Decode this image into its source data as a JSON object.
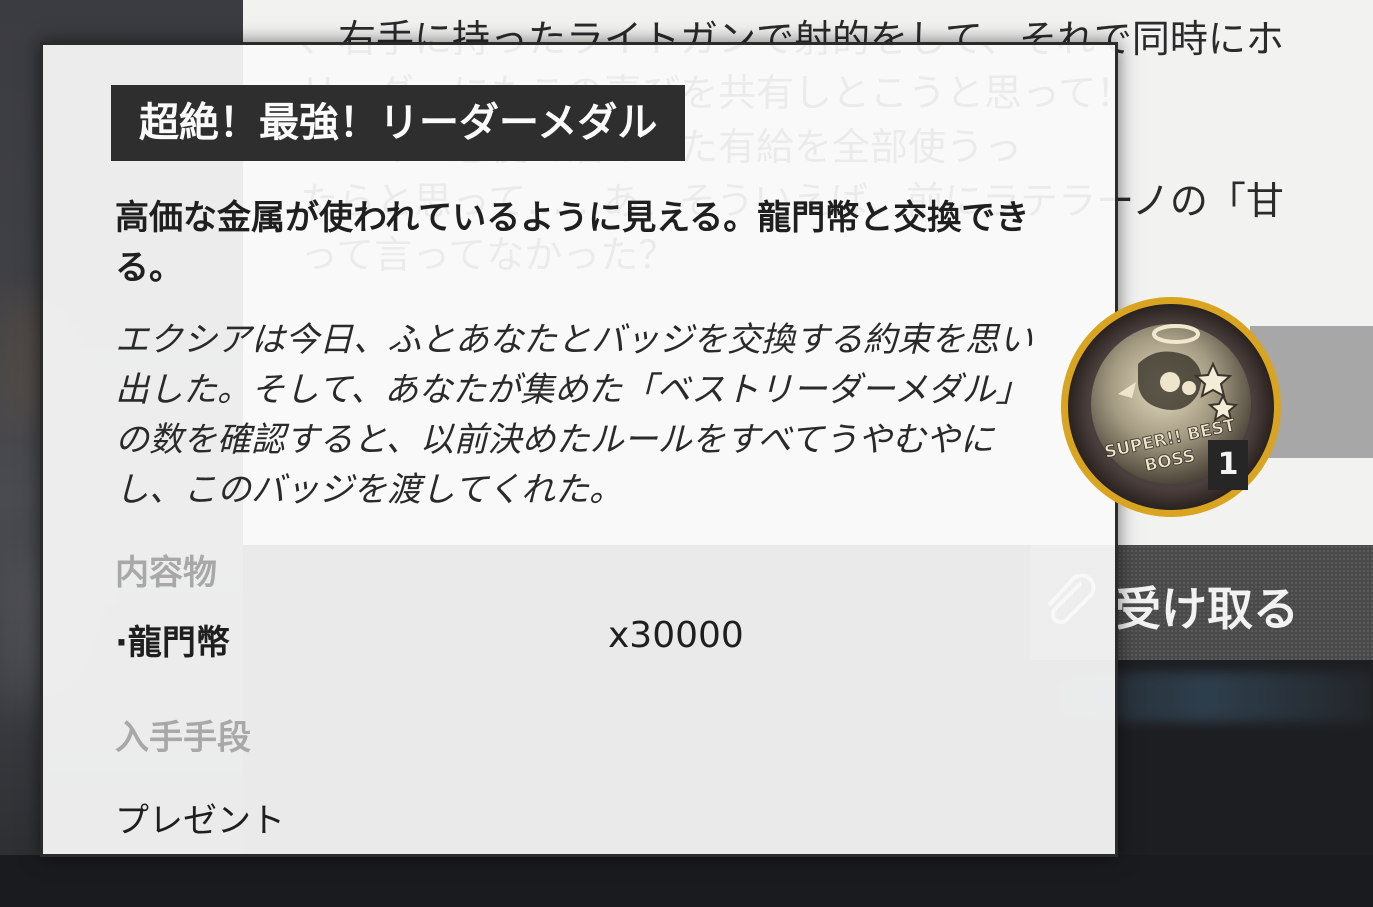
{
  "background": {
    "mail_lines": [
      "、右手に持ったライトガンで射的をして、それで同時にホ",
      "リーダーにもこの喜びを共有しとこうと思って！",
      "ペンギン急便で溜めてた有給を全部使うっ",
      "たらと思って……あ、そういえば、前にラテラーノの「甘",
      "って言ってなかった？"
    ],
    "receive_label": "受け取る"
  },
  "tooltip": {
    "title": "超絶！最強！リーダーメダル",
    "description": "高価な金属が使われているように見える。龍門幣と交換できる。",
    "flavor": "エクシアは今日、ふとあなたとバッジを交換する約束を思い出した。そして、あなたが集めた「ベストリーダーメダル」の数を確認すると、以前決めたルールをすべてうやむやにし、このバッジを渡してくれた。",
    "contents_heading": "内容物",
    "contents": [
      {
        "name": "·龍門幣",
        "quantity": "x30000"
      }
    ],
    "obtain_heading": "入手手段",
    "obtain_method": "プレゼント"
  },
  "medal": {
    "badge_text": "SUPER!! BEST BOSS",
    "count": "1",
    "icon": "medal-icon"
  },
  "colors": {
    "panel_bg": "#fafafa",
    "title_bg": "#2e2e2e",
    "heading_gray": "#a8a8a8",
    "medal_rim": "#d9a520"
  }
}
